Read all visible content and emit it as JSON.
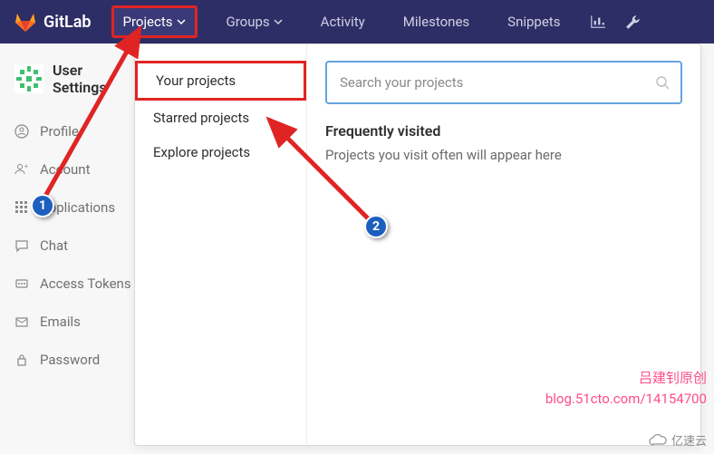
{
  "brand": "GitLab",
  "nav": {
    "projects": "Projects",
    "groups": "Groups",
    "activity": "Activity",
    "milestones": "Milestones",
    "snippets": "Snippets"
  },
  "sidebar": {
    "title": "User Settings",
    "items": [
      {
        "icon": "profile",
        "label": "Profile"
      },
      {
        "icon": "account",
        "label": "Account"
      },
      {
        "icon": "apps",
        "label": "Applications"
      },
      {
        "icon": "chat",
        "label": "Chat"
      },
      {
        "icon": "tokens",
        "label": "Access Tokens"
      },
      {
        "icon": "emails",
        "label": "Emails"
      },
      {
        "icon": "password",
        "label": "Password"
      }
    ]
  },
  "dropdown": {
    "items": [
      "Your projects",
      "Starred projects",
      "Explore projects"
    ],
    "search_placeholder": "Search your projects",
    "freq_title": "Frequently visited",
    "freq_text": "Projects you visit often will appear here"
  },
  "annotations": {
    "badge1": "1",
    "badge2": "2"
  },
  "watermark": {
    "line1": "吕建钊原创",
    "line2": "blog.51cto.com/14154700",
    "brand": "亿速云"
  }
}
